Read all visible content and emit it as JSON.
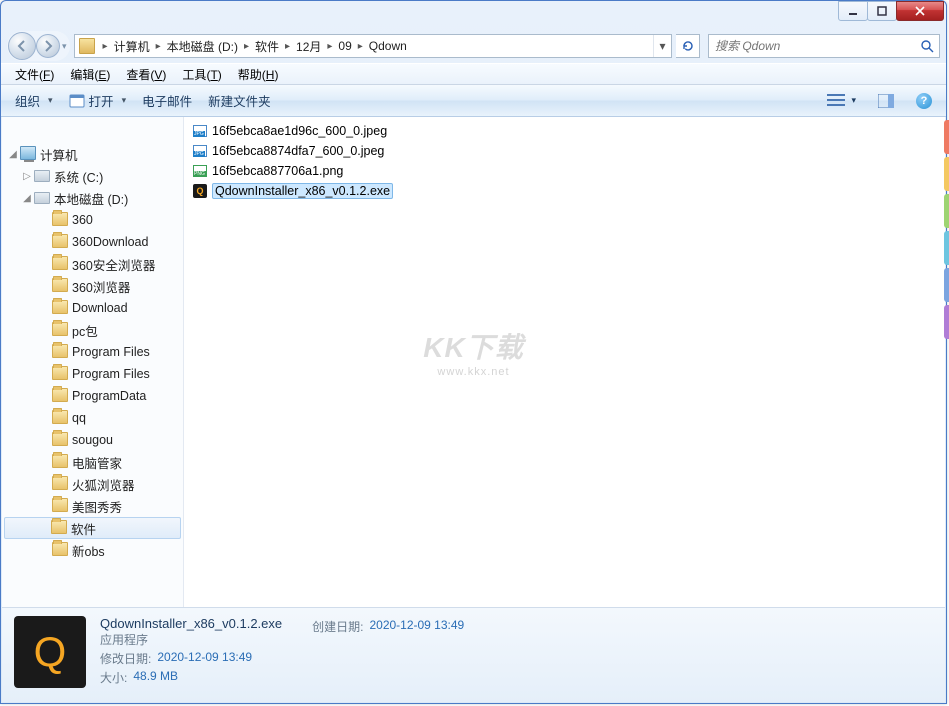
{
  "breadcrumbs": [
    "计算机",
    "本地磁盘 (D:)",
    "软件",
    "12月",
    "09",
    "Qdown"
  ],
  "search": {
    "placeholder": "搜索 Qdown"
  },
  "menubar": [
    {
      "label": "文件",
      "key": "F"
    },
    {
      "label": "编辑",
      "key": "E"
    },
    {
      "label": "查看",
      "key": "V"
    },
    {
      "label": "工具",
      "key": "T"
    },
    {
      "label": "帮助",
      "key": "H"
    }
  ],
  "toolbar": {
    "organize": "组织",
    "open": "打开",
    "email": "电子邮件",
    "newfolder": "新建文件夹"
  },
  "tree": {
    "root": "计算机",
    "sys": "系统 (C:)",
    "local": "本地磁盘 (D:)",
    "folders": [
      "360",
      "360Download",
      "360安全浏览器",
      "360浏览器",
      "Download",
      "pc包",
      "Program Files",
      "Program Files",
      "ProgramData",
      "qq",
      "sougou",
      "电脑管家",
      "火狐浏览器",
      "美图秀秀",
      "软件",
      "新obs"
    ]
  },
  "files": [
    {
      "name": "16f5ebca8ae1d96c_600_0.jpeg",
      "type": "jpg"
    },
    {
      "name": "16f5ebca8874dfa7_600_0.jpeg",
      "type": "jpg"
    },
    {
      "name": "16f5ebca887706a1.png",
      "type": "png"
    },
    {
      "name": "QdownInstaller_x86_v0.1.2.exe",
      "type": "exe",
      "selected": true
    }
  ],
  "details": {
    "filename": "QdownInstaller_x86_v0.1.2.exe",
    "type": "应用程序",
    "created_label": "创建日期:",
    "created": "2020-12-09 13:49",
    "modified_label": "修改日期:",
    "modified": "2020-12-09 13:49",
    "size_label": "大小:",
    "size": "48.9 MB"
  },
  "watermark": {
    "main": "KK下载",
    "sub": "www.kkx.net"
  },
  "tab_colors": [
    "#ef7a63",
    "#f4c861",
    "#9ed472",
    "#6ec5e0",
    "#7ca5e0",
    "#b07dd6"
  ]
}
